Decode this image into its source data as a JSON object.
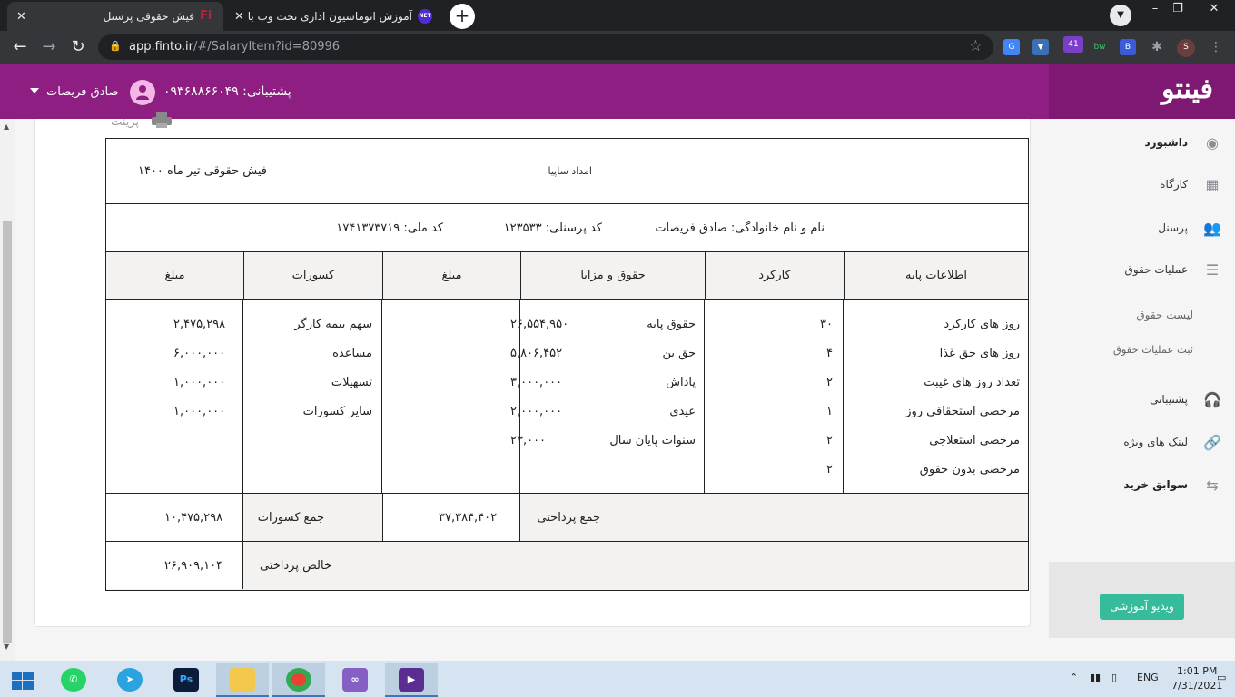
{
  "browser": {
    "tabs": [
      {
        "title": "فیش حقوقی پرسنل",
        "favicon": "Fi",
        "active": true
      },
      {
        "title": "آموزش اتوماسیون اداری تحت وب با",
        "favicon": "NET",
        "active": false
      }
    ],
    "url_host": "app.finto.ir",
    "url_path": "/#/SalaryItem?id=80996",
    "profile_initial": "S",
    "ext_badge": "41",
    "ext_bw": "bw",
    "ext_b": "B"
  },
  "header": {
    "logo": "فینتو",
    "support": "پشتیبانی: ۰۹۳۶۸۸۶۶۰۴۹",
    "username": "صادق فریصات"
  },
  "sidebar": {
    "items": [
      {
        "label": "داشبورد",
        "icon": "dashboard-icon"
      },
      {
        "label": "کارگاه",
        "icon": "grid-icon"
      },
      {
        "label": "پرسنل",
        "icon": "users-icon"
      },
      {
        "label": "عملیات حقوق",
        "icon": "coins-icon"
      },
      {
        "label": "لیست حقوق",
        "icon": ""
      },
      {
        "label": "ثبت عملیات حقوق",
        "icon": ""
      },
      {
        "label": "پشتیبانی",
        "icon": "headset-icon"
      },
      {
        "label": "لینک های ویژه",
        "icon": "link-icon"
      },
      {
        "label": "سوابق خرید",
        "icon": "cart-icon"
      }
    ],
    "video_button": "ویدیو آموزشی"
  },
  "slip": {
    "print_label": "پرینت",
    "title": "فیش حقوقی تیر ماه ۱۴۰۰",
    "company": "امداد ساپیا",
    "name_field": "نام و نام خانوادگی: صادق فریصات",
    "personnel_code": "کد پرسنلی: ۱۲۳۵۳۳",
    "national_code": "کد ملی: ۱۷۴۱۳۷۳۷۱۹",
    "headers": {
      "base_info": "اطلاعات پایه",
      "performance": "کارکرد",
      "salary_benefits": "حقوق و مزایا",
      "amount1": "مبلغ",
      "deductions": "کسورات",
      "amount2": "مبلغ"
    },
    "base_rows": [
      {
        "label": "روز های کارکرد",
        "value": "۳۰"
      },
      {
        "label": "روز های حق غذا",
        "value": "۴"
      },
      {
        "label": "تعداد روز های غیبت",
        "value": "۲"
      },
      {
        "label": "مرخصی استحقاقی روز",
        "value": "۱"
      },
      {
        "label": "مرخصی استعلاجی",
        "value": "۲"
      },
      {
        "label": "مرخصی بدون حقوق",
        "value": "۲"
      }
    ],
    "benefit_rows": [
      {
        "label": "حقوق پایه",
        "value": "۲۶,۵۵۴,۹۵۰"
      },
      {
        "label": "حق بن",
        "value": "۵,۸۰۶,۴۵۲"
      },
      {
        "label": "پاداش",
        "value": "۳,۰۰۰,۰۰۰"
      },
      {
        "label": "عیدی",
        "value": "۲,۰۰۰,۰۰۰"
      },
      {
        "label": "سنوات پایان سال",
        "value": "۲۳,۰۰۰"
      }
    ],
    "deduction_rows": [
      {
        "label": "سهم بیمه کارگر",
        "value": "۲,۴۷۵,۲۹۸"
      },
      {
        "label": "مساعده",
        "value": "۶,۰۰۰,۰۰۰"
      },
      {
        "label": "تسهیلات",
        "value": "۱,۰۰۰,۰۰۰"
      },
      {
        "label": "سایر کسورات",
        "value": "۱,۰۰۰,۰۰۰"
      }
    ],
    "total_pay_label": "جمع پرداختی",
    "total_pay_value": "۳۷,۳۸۴,۴۰۲",
    "total_ded_label": "جمع کسورات",
    "total_ded_value": "۱۰,۴۷۵,۲۹۸",
    "net_label": "خالص پرداختی",
    "net_value": "۲۶,۹۰۹,۱۰۴"
  },
  "taskbar": {
    "lang": "ENG",
    "time": "1:01 PM",
    "date": "7/31/2021"
  }
}
